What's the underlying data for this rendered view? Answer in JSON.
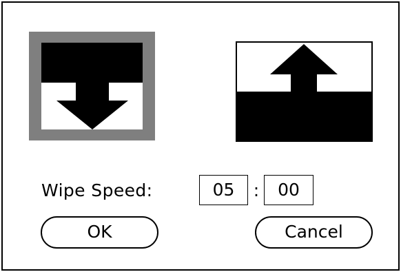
{
  "dialog": {
    "wipe_options": [
      {
        "name": "wipe-down",
        "selected": true
      },
      {
        "name": "wipe-up",
        "selected": false
      }
    ],
    "speed_label": "Wipe Speed:",
    "speed_minutes": "05",
    "speed_separator": ":",
    "speed_seconds": "00",
    "ok_label": "OK",
    "cancel_label": "Cancel"
  },
  "colors": {
    "selection_highlight": "#7f7f7f",
    "foreground": "#000000",
    "background": "#ffffff"
  }
}
